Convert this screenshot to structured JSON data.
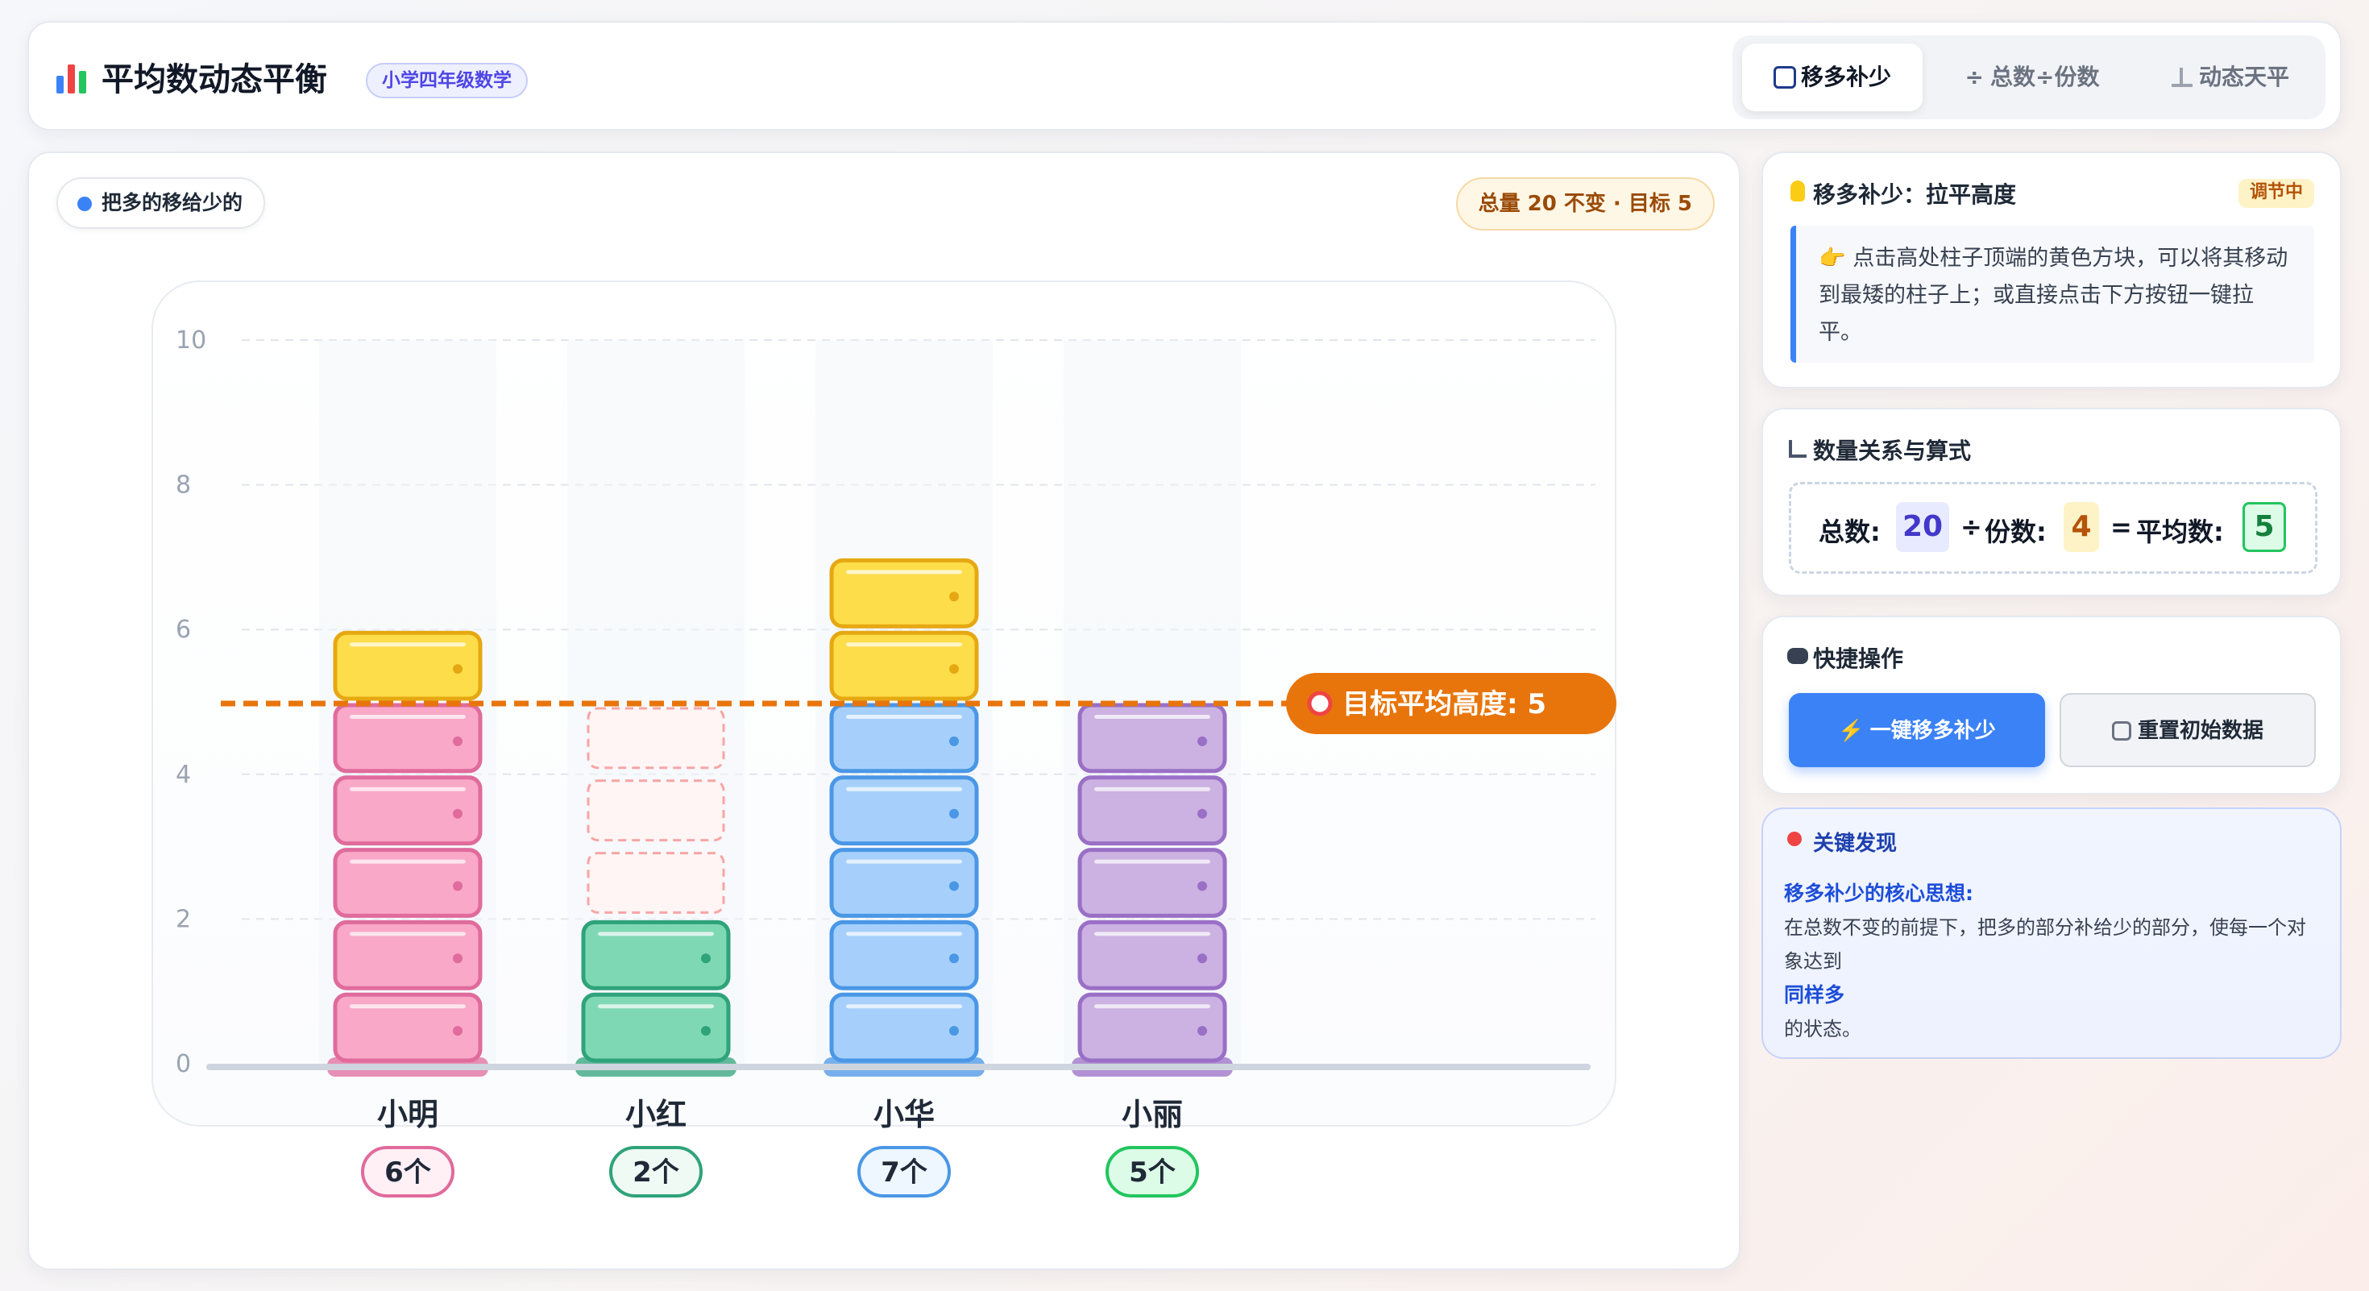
{
  "header": {
    "title": "平均数动态平衡",
    "grade_badge": "小学四年级数学",
    "tabs": [
      {
        "icon": "shuffle-icon",
        "label": "移多补少",
        "active": true
      },
      {
        "icon": "divide-icon",
        "label": "总数÷份数",
        "active": false
      },
      {
        "icon": "scale-icon",
        "label": "动态天平",
        "active": false
      }
    ]
  },
  "main": {
    "hint": "把多的移给少的",
    "total_badge": "总量 20 不变 · 目标 5"
  },
  "chart_data": {
    "type": "bar",
    "categories": [
      "小明",
      "小红",
      "小华",
      "小丽"
    ],
    "values": [
      6,
      2,
      7,
      5
    ],
    "value_labels": [
      "6个",
      "2个",
      "7个",
      "5个"
    ],
    "ylim": [
      0,
      10
    ],
    "yticks": [
      "0",
      "2",
      "4",
      "6",
      "8",
      "10"
    ],
    "grid": true,
    "target": 5,
    "target_label": "目标平均高度: 5",
    "colors": {
      "小明": "#f9a8c8",
      "小红": "#7fd8b4",
      "小华": "#a6d0fb",
      "小丽": "#cbb2e2",
      "surplus": "#fdde4a",
      "target_line": "#e8750b"
    }
  },
  "side": {
    "tip": {
      "title": "移多补少：拉平高度",
      "status": "调节中",
      "body": "👉 点击高处柱子顶端的黄色方块，可以将其移动到最矮的柱子上；或直接点击下方按钮一键拉平。"
    },
    "formula": {
      "title": "数量关系与算式",
      "total_label": "总数:",
      "total": "20",
      "div": "÷",
      "parts_label": "份数:",
      "parts": "4",
      "eq": "=",
      "avg_label": "平均数:",
      "avg": "5"
    },
    "quick": {
      "title": "快捷操作",
      "flatten": "⚡ 一键移多补少",
      "reset": "重置初始数据"
    },
    "finding": {
      "title": "关键发现",
      "heading": "移多补少的核心思想:",
      "text1": "在总数不变的前提下，把多的部分补给少的部分，使每一个对象达到",
      "emph": "同样多",
      "text2": "的状态。"
    }
  }
}
